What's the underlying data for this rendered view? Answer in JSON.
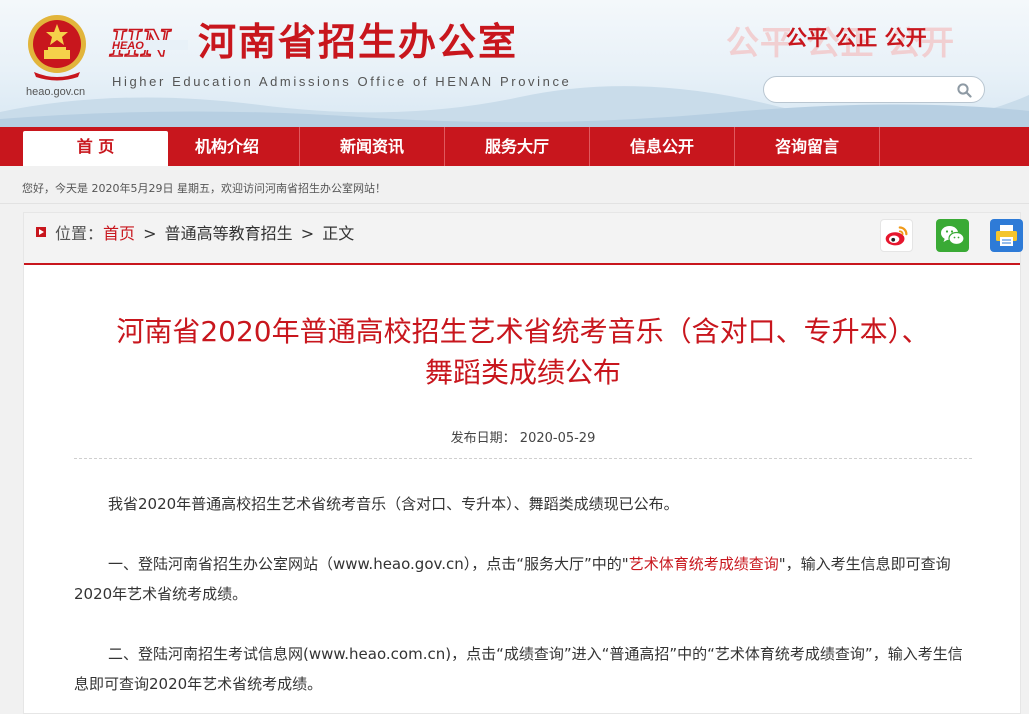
{
  "header": {
    "site_url": "heao.gov.cn",
    "logo_mark": "HEAO",
    "title": "河南省招生办公室",
    "subtitle": "Higher Education Admissions Office of HENAN Province",
    "ghost_slogan": "公平 公正 公开",
    "slogan": "公平 公正 公开",
    "search_placeholder": "",
    "search_icon": "search-icon",
    "brand_color": "#c8161d"
  },
  "nav": {
    "items": [
      {
        "label": "首 页",
        "active": true
      },
      {
        "label": "机构介绍"
      },
      {
        "label": "新闻资讯"
      },
      {
        "label": "服务大厅"
      },
      {
        "label": "信息公开"
      },
      {
        "label": "咨询留言"
      }
    ]
  },
  "welcome": "您好，今天是 2020年5月29日 星期五，欢迎访问河南省招生办公室网站！",
  "breadcrumb": {
    "label": "位置：",
    "home": "首页",
    "sep": ">",
    "section": "普通高等教育招生",
    "current": "正文"
  },
  "share": {
    "icons": [
      "weibo-icon",
      "wechat-icon",
      "print-icon"
    ]
  },
  "article": {
    "title_line1": "河南省2020年普通高校招生艺术省统考音乐（含对口、专升本）、",
    "title_line2": "舞蹈类成绩公布",
    "date_label": "发布日期：",
    "date": "2020-05-29",
    "p1": "我省2020年普通高校招生艺术省统考音乐（含对口、专升本）、舞蹈类成绩现已公布。",
    "p2_pre": "一、登陆河南省招生办公室网站（www.heao.gov.cn），点击“服务大厅”中的\"",
    "p2_link": "艺术体育统考成绩查询",
    "p2_post": "\"，输入考生信息即可查询2020年艺术省统考成绩。",
    "p3": "二、登陆河南招生考试信息网(www.heao.com.cn)，点击“成绩查询”进入“普通高招”中的“艺术体育统考成绩查询”，输入考生信息即可查询2020年艺术省统考成绩。"
  }
}
